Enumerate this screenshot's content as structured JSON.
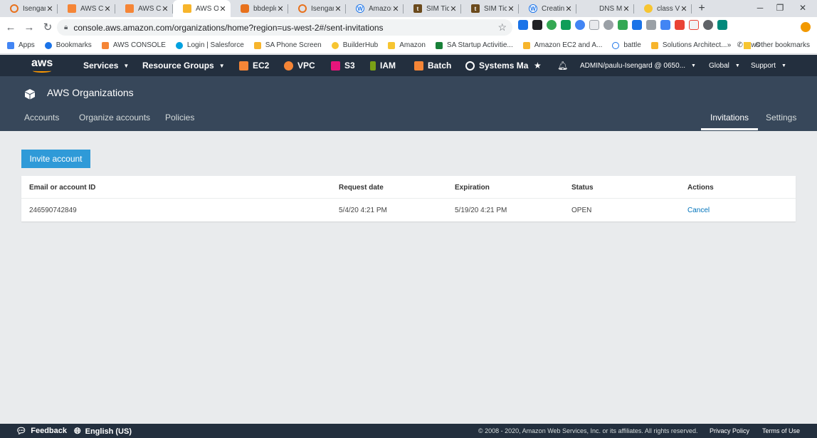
{
  "browser": {
    "tabs": [
      {
        "title": "Isengard",
        "icon": "isengard-icon",
        "active": false
      },
      {
        "title": "AWS Co",
        "icon": "aws-cube-icon",
        "active": false
      },
      {
        "title": "AWS Co",
        "icon": "aws-cube-icon",
        "active": false
      },
      {
        "title": "AWS Or",
        "icon": "aws-organizations-icon",
        "active": true
      },
      {
        "title": "bbdeplo",
        "icon": "bbdeploy-icon",
        "active": false
      },
      {
        "title": "Isengard",
        "icon": "isengard-icon",
        "active": false
      },
      {
        "title": "Amazon",
        "icon": "wiki-icon",
        "active": false
      },
      {
        "title": "SIM Tick",
        "icon": "sim-ticket-icon",
        "active": false
      },
      {
        "title": "SIM Tick",
        "icon": "sim-ticket-icon",
        "active": false
      },
      {
        "title": "Creating",
        "icon": "wiki-icon",
        "active": false
      },
      {
        "title": "DNS Ma",
        "icon": "blank-icon",
        "active": false
      },
      {
        "title": "class Vp",
        "icon": "class-icon",
        "active": false
      }
    ],
    "tab_close": "✕",
    "new_tab": "+",
    "window_controls": {
      "minimize": "─",
      "restore": "❐",
      "close": "✕"
    },
    "url": "console.aws.amazon.com/organizations/home?region=us-west-2#/sent-invitations",
    "bookmarks": [
      {
        "label": "Apps",
        "icon": "apps-grid-icon",
        "color": "#4285f4"
      },
      {
        "label": "Bookmarks",
        "icon": "star-icon",
        "color": "#1a73e8"
      },
      {
        "label": "AWS CONSOLE",
        "icon": "aws-cube-icon",
        "color": "#f58536"
      },
      {
        "label": "Login | Salesforce",
        "icon": "salesforce-icon",
        "color": "#00a1e0"
      },
      {
        "label": "SA Phone Screen",
        "icon": "folder-icon",
        "color": "#f7b52c"
      },
      {
        "label": "BuilderHub",
        "icon": "builderhub-icon",
        "color": "#f7c531"
      },
      {
        "label": "Amazon",
        "icon": "folder-icon",
        "color": "#f7c531"
      },
      {
        "label": "SA Startup Activitie...",
        "icon": "sheet-icon",
        "color": "#188038"
      },
      {
        "label": "Amazon EC2 and A...",
        "icon": "aws-cube-icon",
        "color": "#f7b52c"
      },
      {
        "label": "battle",
        "icon": "wiki-icon",
        "color": "#1a73e8"
      },
      {
        "label": "Solutions Architect...",
        "icon": "folder-icon",
        "color": "#f7b52c"
      },
      {
        "label": "aws",
        "icon": "phone-icon",
        "color": "#333333"
      }
    ],
    "bookmarks_overflow": "»",
    "other_bookmarks": "Other bookmarks"
  },
  "aws_nav": {
    "logo": "aws",
    "services": "Services",
    "resource_groups": "Resource Groups",
    "shortcuts": [
      {
        "label": "EC2",
        "icon": "ec2-icon",
        "color": "#f58536"
      },
      {
        "label": "VPC",
        "icon": "vpc-icon",
        "color": "#f58536"
      },
      {
        "label": "S3",
        "icon": "s3-icon",
        "color": "#e7157b"
      },
      {
        "label": "IAM",
        "icon": "iam-icon",
        "color": "#7aa116"
      },
      {
        "label": "Batch",
        "icon": "batch-icon",
        "color": "#f58536"
      },
      {
        "label": "Systems Ma",
        "icon": "systems-manager-icon",
        "color": "#ffffff"
      }
    ],
    "account": "ADMIN/paulu-Isengard @ 0650...",
    "region": "Global",
    "support": "Support"
  },
  "org": {
    "title": "AWS Organizations",
    "tabs_left": [
      "Accounts",
      "Organize accounts",
      "Policies"
    ],
    "tabs_right": [
      "Invitations",
      "Settings"
    ],
    "active_tab": "Invitations"
  },
  "content": {
    "invite_button": "Invite account",
    "columns": [
      "Email or account ID",
      "Request date",
      "Expiration",
      "Status",
      "Actions"
    ],
    "rows": [
      {
        "account": "246590742849",
        "request_date": "5/4/20 4:21 PM",
        "expiration": "5/19/20 4:21 PM",
        "status": "OPEN",
        "action": "Cancel"
      }
    ]
  },
  "footer": {
    "feedback": "Feedback",
    "language": "English (US)",
    "copyright": "© 2008 - 2020, Amazon Web Services, Inc. or its affiliates. All rights reserved.",
    "privacy": "Privacy Policy",
    "terms": "Terms of Use"
  }
}
